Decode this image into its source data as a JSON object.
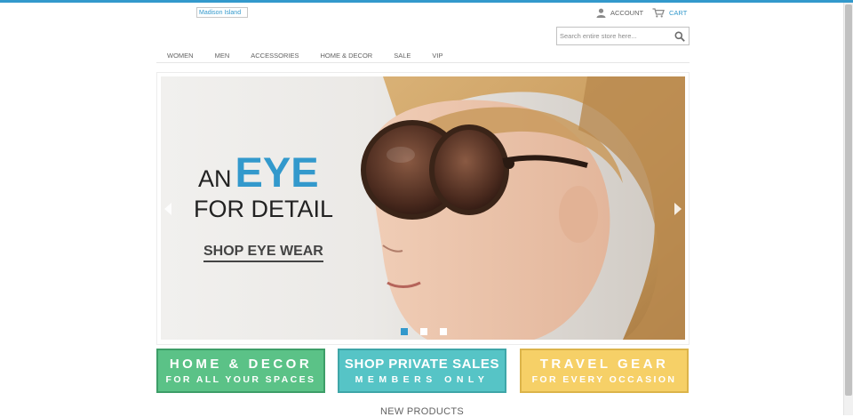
{
  "header": {
    "logo_alt": "Madison Island",
    "account_label": "ACCOUNT",
    "cart_label": "CART",
    "search": {
      "placeholder": "Search entire store here..."
    }
  },
  "nav": {
    "items": [
      {
        "label": "WOMEN"
      },
      {
        "label": "MEN"
      },
      {
        "label": "ACCESSORIES"
      },
      {
        "label": "HOME & DECOR"
      },
      {
        "label": "SALE"
      },
      {
        "label": "VIP"
      }
    ]
  },
  "slider": {
    "headline_prefix": "AN",
    "headline_accent": "EYE",
    "headline_line2": "FOR DETAIL",
    "cta": "SHOP EYE WEAR",
    "active_slide": 1,
    "slide_count": 3
  },
  "promos": [
    {
      "line1": "HOME & DECOR",
      "line2": "FOR ALL YOUR SPACES",
      "color": "#5bc287"
    },
    {
      "line1": "SHOP PRIVATE SALES",
      "line2": "MEMBERS ONLY",
      "color": "#56c4c6"
    },
    {
      "line1": "TRAVEL GEAR",
      "line2": "FOR EVERY OCCASION",
      "color": "#f6d067"
    }
  ],
  "sections": {
    "new_products": "NEW PRODUCTS"
  },
  "colors": {
    "accent": "#3399cc",
    "text": "#636363"
  }
}
